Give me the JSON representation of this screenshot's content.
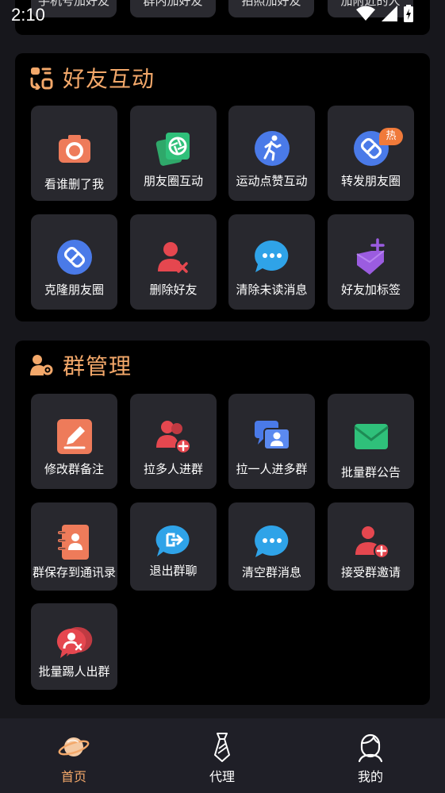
{
  "status": {
    "time": "2:10"
  },
  "top_partial_tiles": [
    "手机号加好友",
    "群内加好友",
    "拍照加好友",
    "加附近的人"
  ],
  "sections": [
    {
      "title": "好友互动",
      "items": [
        {
          "label": "看谁删了我",
          "icon": "camera-icon"
        },
        {
          "label": "朋友圈互动",
          "icon": "photo-album-icon"
        },
        {
          "label": "运动点赞互动",
          "icon": "running-icon"
        },
        {
          "label": "转发朋友圈",
          "icon": "share-link-icon",
          "badge": "热"
        },
        {
          "label": "克隆朋友圈",
          "icon": "clone-link-icon"
        },
        {
          "label": "删除好友",
          "icon": "delete-user-icon"
        },
        {
          "label": "清除未读消息",
          "icon": "chat-bubble-icon"
        },
        {
          "label": "好友加标签",
          "icon": "tag-icon"
        }
      ]
    },
    {
      "title": "群管理",
      "items": [
        {
          "label": "修改群备注",
          "icon": "edit-icon"
        },
        {
          "label": "拉多人进群",
          "icon": "add-users-icon"
        },
        {
          "label": "拉一人进多群",
          "icon": "chat-user-icon"
        },
        {
          "label": "批量群公告",
          "icon": "mail-icon"
        },
        {
          "label": "群保存到通讯录",
          "icon": "contacts-book-icon"
        },
        {
          "label": "退出群聊",
          "icon": "exit-chat-icon"
        },
        {
          "label": "清空群消息",
          "icon": "chat-bubble-icon"
        },
        {
          "label": "接受群邀请",
          "icon": "accept-invite-icon"
        },
        {
          "label": "批量踢人出群",
          "icon": "kick-user-icon"
        }
      ]
    }
  ],
  "tabs": [
    {
      "label": "首页",
      "icon": "planet-icon",
      "active": true
    },
    {
      "label": "代理",
      "icon": "tie-icon",
      "active": false
    },
    {
      "label": "我的",
      "icon": "profile-icon",
      "active": false
    }
  ],
  "colors": {
    "accent": "#f3a86a",
    "card": "#000000",
    "tile": "#28282e",
    "tabbar": "#1f1f27"
  }
}
